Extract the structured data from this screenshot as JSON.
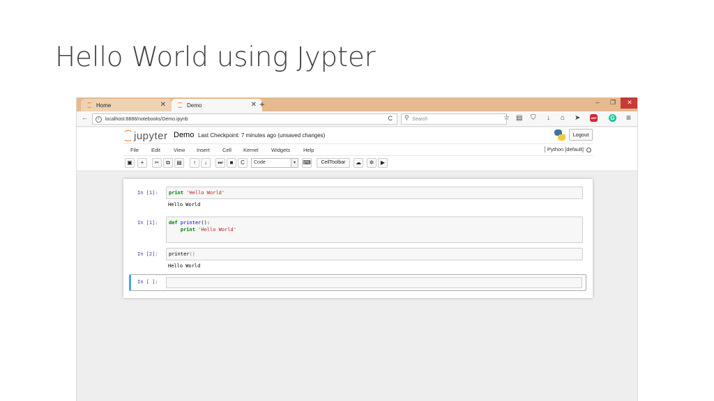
{
  "slide": {
    "title": "Hello World using Jypter"
  },
  "browser": {
    "tabs": [
      {
        "label": "Home",
        "close": "✕"
      },
      {
        "label": "Demo",
        "close": "✕"
      }
    ],
    "new_tab": "+",
    "window_controls": {
      "minimize": "–",
      "restore": "❐",
      "close": "✕"
    },
    "nav": {
      "back": "←",
      "url": "localhost:8888/notebooks/Demo.ipynb",
      "reload": "C",
      "search_placeholder": "Search"
    },
    "toolbar_icons": [
      "star-icon",
      "reading-list-icon",
      "pocket-icon",
      "download-icon",
      "home-icon",
      "send-icon",
      "adblock-icon",
      "grammarly-icon",
      "menu-icon"
    ],
    "toolbar_glyphs": {
      "star": "☆",
      "reading": "▤",
      "pocket": "⛉",
      "download": "↓",
      "home": "⌂",
      "send": "➤",
      "abp": "ABP",
      "grammarly": "G",
      "menu": "≡"
    }
  },
  "jupyter": {
    "logo_text": "jupyter",
    "notebook_name": "Demo",
    "checkpoint": "Last Checkpoint: 7 minutes ago (unsaved changes)",
    "logout_label": "Logout",
    "menu": [
      "File",
      "Edit",
      "View",
      "Insert",
      "Cell",
      "Kernel",
      "Widgets",
      "Help"
    ],
    "kernel": "Python [default]",
    "toolbar": {
      "save": "▣",
      "add": "+",
      "cut": "✂",
      "copy": "⧉",
      "paste": "▤",
      "up": "↑",
      "down": "↓",
      "run": "⏭",
      "stop": "■",
      "restart": "C",
      "cell_type": "Code",
      "dropdown": "▾",
      "keyboard": "⌨",
      "celltoolbar": "CellToolbar",
      "upload": "☁",
      "present": "✲",
      "video": "▶"
    },
    "cells": [
      {
        "prompt": "In [1]:",
        "code": [
          {
            "t": "print",
            "c": "kw"
          },
          {
            "t": " ",
            "c": ""
          },
          {
            "t": "'Hello World'",
            "c": "st"
          }
        ],
        "output": "Hello World"
      },
      {
        "prompt": "In [1]:",
        "line1": [
          {
            "t": "def",
            "c": "kw"
          },
          {
            "t": " ",
            "c": ""
          },
          {
            "t": "printer",
            "c": "fn"
          },
          {
            "t": "():",
            "c": ""
          }
        ],
        "line2": [
          {
            "t": "    ",
            "c": ""
          },
          {
            "t": "print",
            "c": "kw"
          },
          {
            "t": " ",
            "c": ""
          },
          {
            "t": "'Hello World'",
            "c": "st"
          }
        ]
      },
      {
        "prompt": "In [2]:",
        "code": [
          {
            "t": "printer",
            "c": ""
          },
          {
            "t": "()",
            "c": "par"
          }
        ],
        "output": "Hello World"
      },
      {
        "prompt": "In [ ]:"
      }
    ]
  }
}
